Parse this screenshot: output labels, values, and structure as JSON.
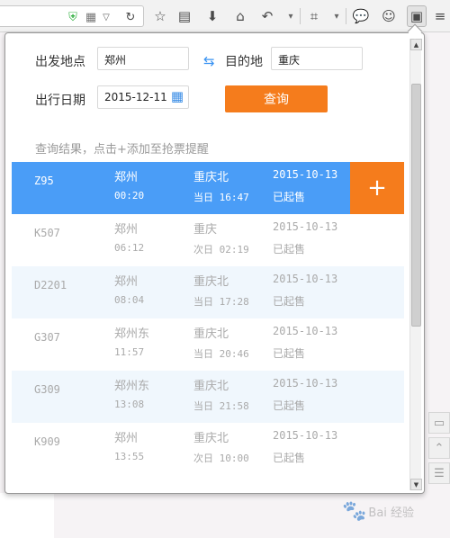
{
  "toolbar": {
    "icons": [
      "shield-check-icon",
      "qr-code-icon",
      "dropdown-arrow-icon",
      "refresh-icon",
      "star-icon",
      "reading-list-icon",
      "download-icon",
      "home-icon",
      "undo-icon",
      "crop-icon",
      "chat-icon",
      "emoji-icon",
      "ticket-extension-icon"
    ]
  },
  "form": {
    "from_label": "出发地点",
    "from_value": "郑州",
    "to_label": "目的地",
    "to_value": "重庆",
    "date_label": "出行日期",
    "date_value": "2015-12-11",
    "query_label": "查询"
  },
  "hint": "查询结果，点击+添加至抢票提醒",
  "add_label": "+",
  "trains": [
    {
      "train": "Z95",
      "from": "郑州",
      "dep": "00:20",
      "to": "重庆北",
      "arr": "当日 16:47",
      "date": "2015-10-13",
      "status": "已起售"
    },
    {
      "train": "K507",
      "from": "郑州",
      "dep": "06:12",
      "to": "重庆",
      "arr": "次日 02:19",
      "date": "2015-10-13",
      "status": "已起售"
    },
    {
      "train": "D2201",
      "from": "郑州",
      "dep": "08:04",
      "to": "重庆北",
      "arr": "当日 17:28",
      "date": "2015-10-13",
      "status": "已起售"
    },
    {
      "train": "G307",
      "from": "郑州东",
      "dep": "11:57",
      "to": "重庆北",
      "arr": "当日 20:46",
      "date": "2015-10-13",
      "status": "已起售"
    },
    {
      "train": "G309",
      "from": "郑州东",
      "dep": "13:08",
      "to": "重庆北",
      "arr": "当日 21:58",
      "date": "2015-10-13",
      "status": "已起售"
    },
    {
      "train": "K909",
      "from": "郑州",
      "dep": "13:55",
      "to": "重庆北",
      "arr": "次日 10:00",
      "date": "2015-10-13",
      "status": "已起售"
    }
  ],
  "watermark": "Bai 经验",
  "colors": {
    "accent": "#f57c1c",
    "selected_row": "#4a9df7",
    "alt_row": "#f0f7fd",
    "swap_icon": "#3a93f2"
  }
}
